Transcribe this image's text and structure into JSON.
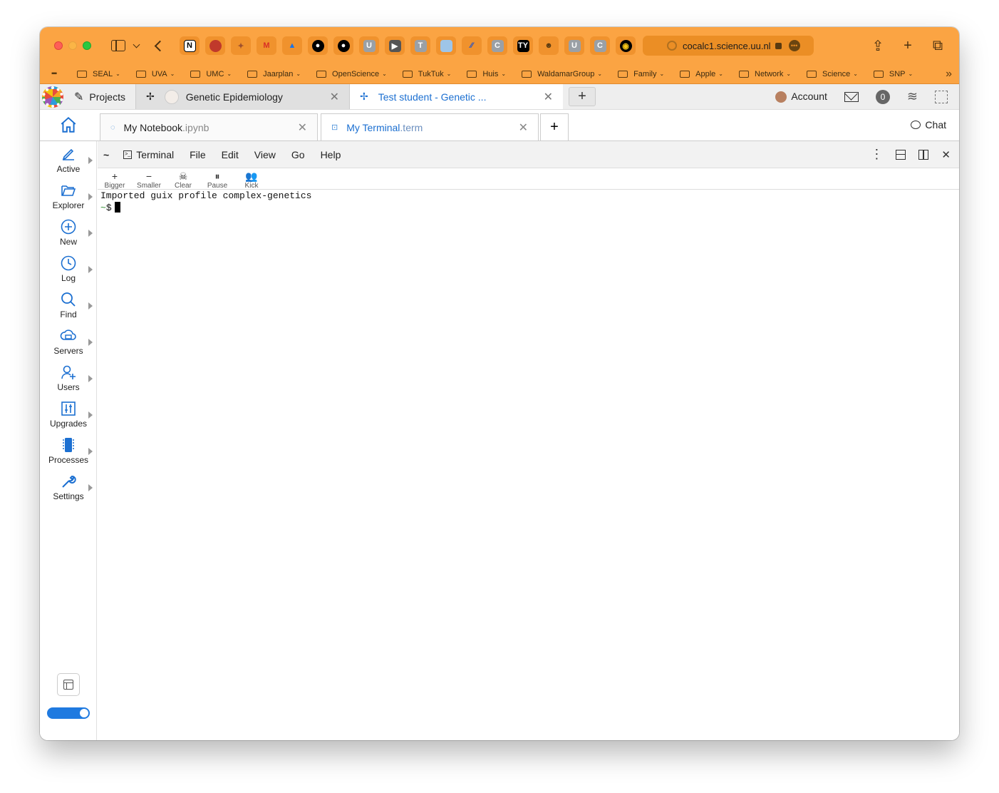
{
  "browser": {
    "url": "cocalc1.science.uu.nl",
    "favorites": [
      "notion-icon",
      "ravenclaw-icon",
      "fox-icon",
      "gmail-icon",
      "drive-icon",
      "github-icon",
      "github-icon",
      "u-icon",
      "arrow-icon",
      "t-icon",
      "square-icon",
      "slash-icon",
      "c-icon",
      "ty-icon",
      "cat-icon",
      "u-icon",
      "c-icon",
      "circle-icon"
    ],
    "fav_letters": [
      "N",
      "",
      "",
      "M",
      "",
      "",
      "",
      "U",
      "",
      "T",
      "",
      "",
      "C",
      "TY",
      "",
      "U",
      "C",
      ""
    ],
    "bookmarks": [
      {
        "label": "SEAL"
      },
      {
        "label": "UVA"
      },
      {
        "label": "UMC"
      },
      {
        "label": "Jaarplan"
      },
      {
        "label": "OpenScience"
      },
      {
        "label": "TukTuk"
      },
      {
        "label": "Huis"
      },
      {
        "label": "WaldamarGroup"
      },
      {
        "label": "Family"
      },
      {
        "label": "Apple"
      },
      {
        "label": "Network"
      },
      {
        "label": "Science"
      },
      {
        "label": "SNP"
      }
    ]
  },
  "cocalc": {
    "projects_label": "Projects",
    "project_tabs": [
      {
        "label": "Genetic Epidemiology",
        "active": false
      },
      {
        "label": "Test student - Genetic ...",
        "active": true
      }
    ],
    "account_label": "Account",
    "notifications_count": "0",
    "file_tabs": [
      {
        "name": "My Notebook",
        "ext": ".ipynb",
        "active": false
      },
      {
        "name": "My Terminal",
        "ext": ".term",
        "active": true
      }
    ],
    "chat_label": "Chat",
    "nav": [
      {
        "label": "Active"
      },
      {
        "label": "Explorer"
      },
      {
        "label": "New"
      },
      {
        "label": "Log"
      },
      {
        "label": "Find"
      },
      {
        "label": "Servers"
      },
      {
        "label": "Users"
      },
      {
        "label": "Upgrades"
      },
      {
        "label": "Processes"
      },
      {
        "label": "Settings"
      }
    ],
    "menu": {
      "tilde": "~",
      "terminal": "Terminal",
      "items": [
        "File",
        "Edit",
        "View",
        "Go",
        "Help"
      ]
    },
    "buttons": [
      {
        "label": "Bigger",
        "glyph": "+"
      },
      {
        "label": "Smaller",
        "glyph": "−"
      },
      {
        "label": "Clear",
        "glyph": "☠"
      },
      {
        "label": "Pause",
        "glyph": "⏸"
      },
      {
        "label": "Kick",
        "glyph": "👥"
      }
    ],
    "terminal": {
      "line1": "Imported guix profile complex-genetics",
      "prompt_tilde": "~",
      "prompt_symbol": "$"
    }
  },
  "colors": {
    "browser_accent": "#fba443",
    "link_blue": "#1b6fd1",
    "toggle_blue": "#1f7ae0"
  }
}
